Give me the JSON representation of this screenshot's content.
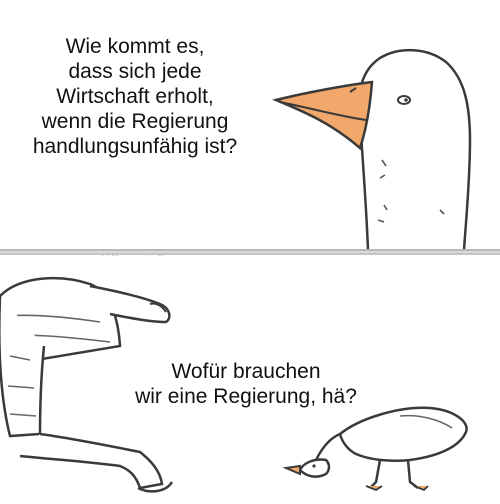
{
  "panels": {
    "top": {
      "caption": "Wie kommt es,\ndass sich jede\nWirtschaft erholt,\nwenn die Regierung\nhandlungsunfähig ist?"
    },
    "bottom": {
      "caption": "Wofür brauchen\nwir eine Regierung, hä?"
    }
  },
  "watermark": "@RosarotePanzer",
  "colors": {
    "beak": "#f2a86a",
    "line": "#3a3a3a",
    "divider": "#d9d9d9"
  }
}
